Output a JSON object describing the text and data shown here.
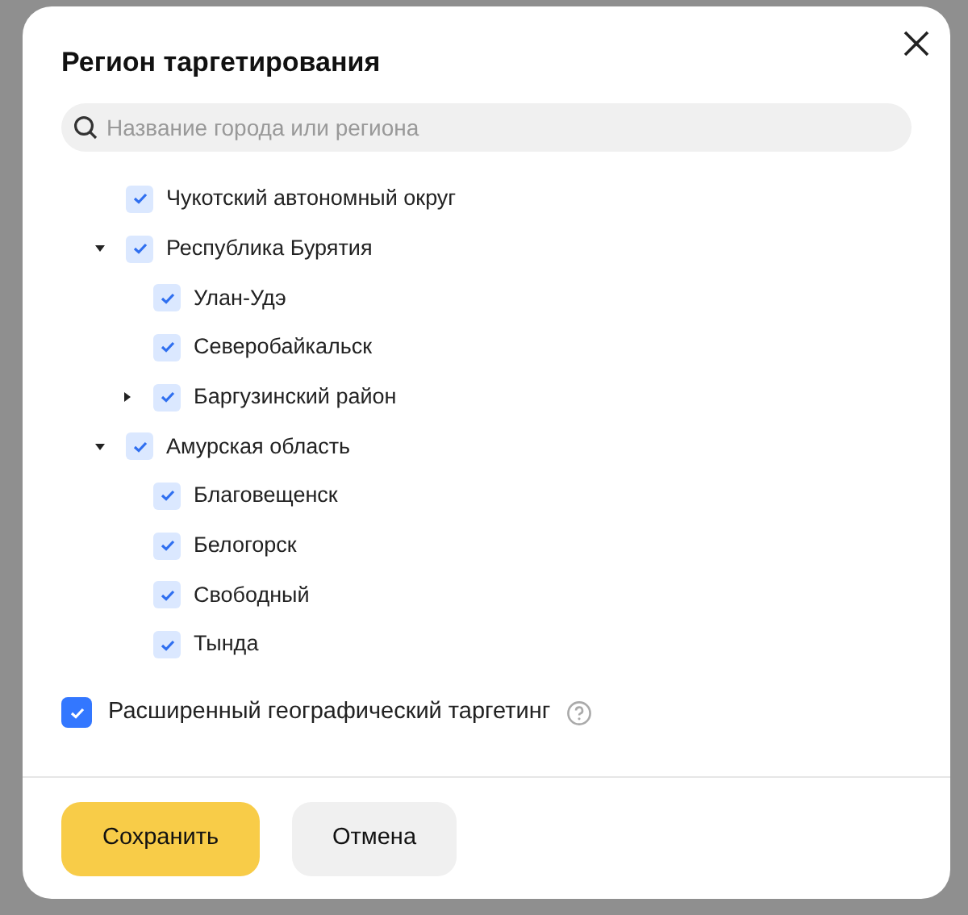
{
  "dialog": {
    "title": "Регион таргетирования",
    "search": {
      "placeholder": "Название города или региона"
    },
    "tree": [
      {
        "label": "Чукотский автономный округ",
        "checked": true
      },
      {
        "label": "Республика Бурятия",
        "checked": true,
        "expanded": true,
        "children": [
          {
            "label": "Улан-Удэ",
            "checked": true
          },
          {
            "label": "Северобайкальск",
            "checked": true
          },
          {
            "label": "Баргузинский район",
            "checked": true,
            "expanded": false
          }
        ]
      },
      {
        "label": "Амурская область",
        "checked": true,
        "expanded": true,
        "children": [
          {
            "label": "Благовещенск",
            "checked": true
          },
          {
            "label": "Белогорск",
            "checked": true
          },
          {
            "label": "Свободный",
            "checked": true
          },
          {
            "label": "Тында",
            "checked": true
          }
        ]
      }
    ],
    "extended_targeting": {
      "label": "Расширенный географический таргетинг",
      "checked": true
    },
    "buttons": [
      {
        "label": "Сохранить",
        "kind": "primary"
      },
      {
        "label": "Отмена",
        "kind": "secondary"
      }
    ]
  }
}
